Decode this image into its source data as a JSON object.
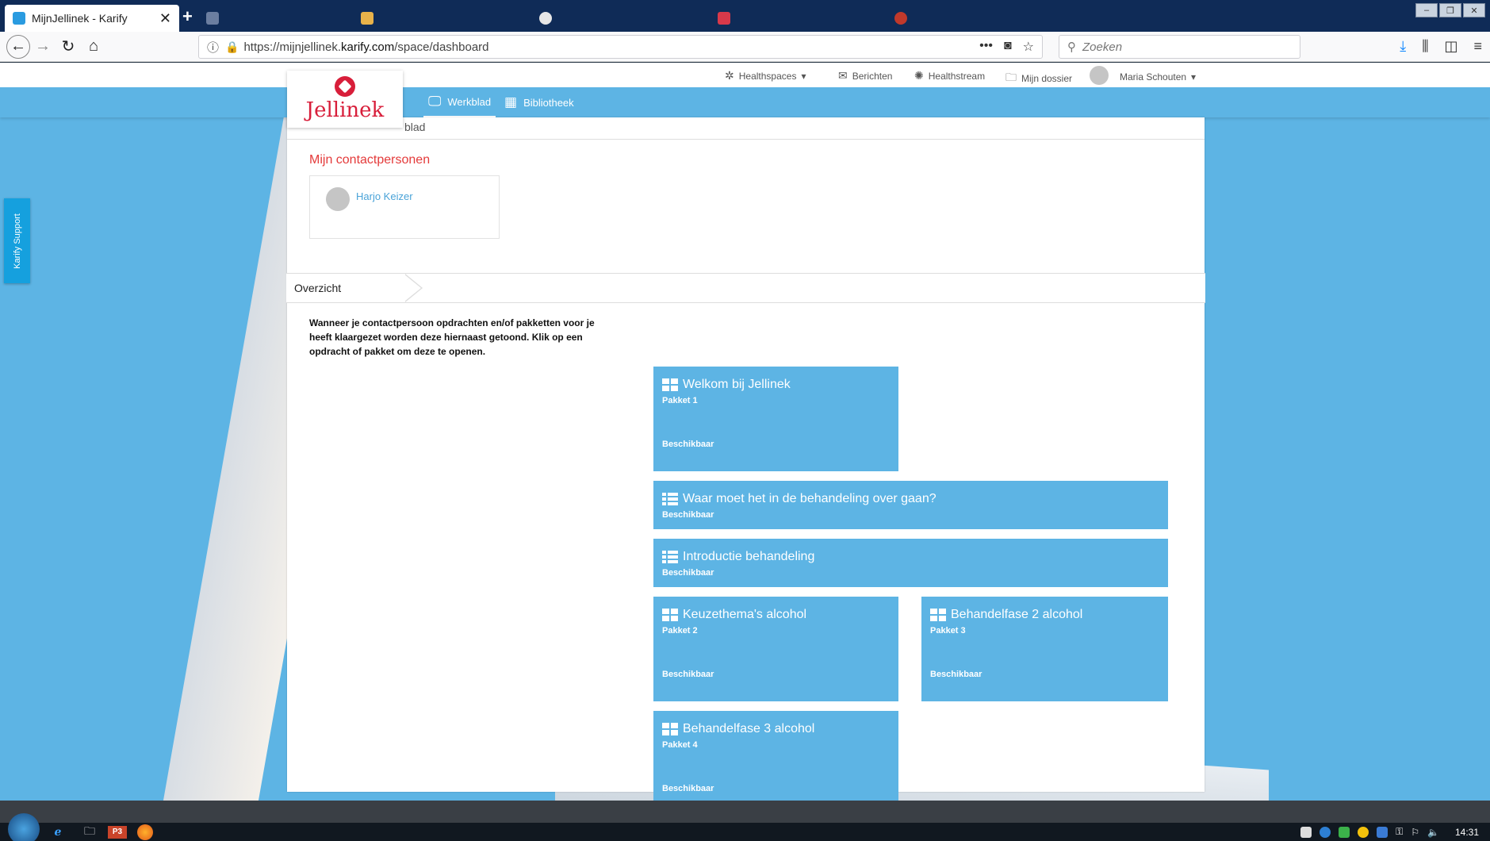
{
  "browser": {
    "tabs": [
      {
        "label": "MijnJellinek - Karify",
        "active": true
      },
      {
        "label": "",
        "active": false
      },
      {
        "label": "",
        "active": false
      },
      {
        "label": "",
        "active": false
      },
      {
        "label": "",
        "active": false
      },
      {
        "label": "",
        "active": false
      },
      {
        "label": "",
        "active": false
      },
      {
        "label": "",
        "active": false
      }
    ],
    "tab_close": "✕",
    "new_tab": "+",
    "url_prefix": "https://mijnjellinek.",
    "url_host": "karify.com",
    "url_path": "/space/dashboard",
    "search_placeholder": "Zoeken",
    "icons": {
      "back": "arrow-left",
      "forward": "arrow-right",
      "reload": "reload",
      "home": "home",
      "info": "info",
      "lock": "lock",
      "more": "more",
      "pocket": "pocket",
      "bookmark": "star",
      "download": "download",
      "library": "library",
      "sidebar": "sidebar",
      "menu": "hamburger"
    }
  },
  "usermenu": {
    "healthspaces": "Healthspaces",
    "berichten": "Berichten",
    "healthstream": "Healthstream",
    "dossier": "Mijn dossier",
    "user": "Maria Schouten"
  },
  "mainnav": {
    "logo": "Jellinek",
    "werkblad": "Werkblad",
    "bibliotheek": "Bibliotheek"
  },
  "support": {
    "label": "Karify Support"
  },
  "content": {
    "breadcrumb": "blad",
    "contacts_title": "Mijn contactpersonen",
    "contact_name": "Harjo Keizer",
    "overview_tab": "Overzicht",
    "intro": "Wanneer je contactpersoon opdrachten en/of pakketten voor je heeft klaargezet worden deze hiernaast getoond. Klik op een opdracht of pakket om deze te openen.",
    "tiles": [
      {
        "title": "Welkom bij Jellinek",
        "sub": "Pakket 1",
        "status": "Beschikbaar",
        "icon": "grid"
      },
      {
        "title": "Waar moet het in de behandeling over gaan?",
        "sub": "",
        "status": "Beschikbaar",
        "icon": "list"
      },
      {
        "title": "Introductie behandeling",
        "sub": "",
        "status": "Beschikbaar",
        "icon": "list"
      },
      {
        "title": "Keuzethema's alcohol",
        "sub": "Pakket 2",
        "status": "Beschikbaar",
        "icon": "grid"
      },
      {
        "title": "Behandelfase 2 alcohol",
        "sub": "Pakket 3",
        "status": "Beschikbaar",
        "icon": "grid"
      },
      {
        "title": "Behandelfase 3 alcohol",
        "sub": "Pakket 4",
        "status": "Beschikbaar",
        "icon": "grid"
      }
    ]
  },
  "taskbar": {
    "clock": "14:31",
    "powerpoint_label": "P3"
  },
  "colors": {
    "accent": "#5db4e4",
    "brand_red": "#d81e3a",
    "contact_title": "#e43a3a",
    "link": "#4aa3d8",
    "support": "#15a0de"
  }
}
